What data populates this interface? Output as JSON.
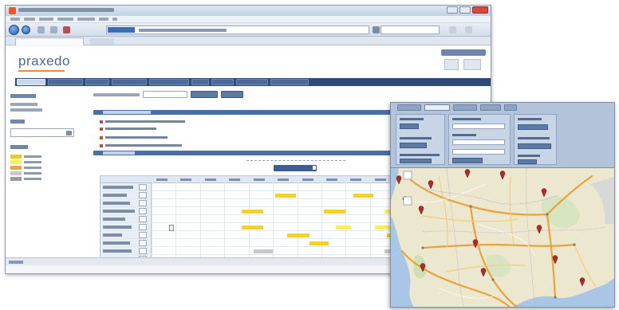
{
  "browser": {
    "window_title": "",
    "url": "",
    "tab_label": ""
  },
  "app": {
    "logo_text": "praxedo",
    "nav_tabs": [
      {
        "label": "",
        "active": true
      },
      {
        "label": "",
        "active": false
      },
      {
        "label": "",
        "active": false
      },
      {
        "label": "",
        "active": false
      },
      {
        "label": "",
        "active": false
      },
      {
        "label": "",
        "active": false
      },
      {
        "label": "",
        "active": false
      },
      {
        "label": "",
        "active": false
      },
      {
        "label": "",
        "active": false
      }
    ]
  },
  "sidebar": {
    "legend": [
      {
        "color": "#f2c714"
      },
      {
        "color": "#f7ef5a"
      },
      {
        "color": "#e6a64a"
      },
      {
        "color": "#c9c9c9"
      },
      {
        "color": "#9a9a9a"
      }
    ]
  },
  "planning": {
    "bar_color": "#f0d22a",
    "light_bar_color": "#ffee55",
    "rows": 10,
    "columns": 14
  },
  "map": {
    "pin_color": "#b02a2a"
  },
  "icons": [
    "back-arrow-icon",
    "forward-arrow-icon",
    "refresh-icon",
    "home-icon",
    "calendar-icon",
    "map-pin-icon",
    "close-icon",
    "minimize-icon",
    "maximize-icon"
  ]
}
